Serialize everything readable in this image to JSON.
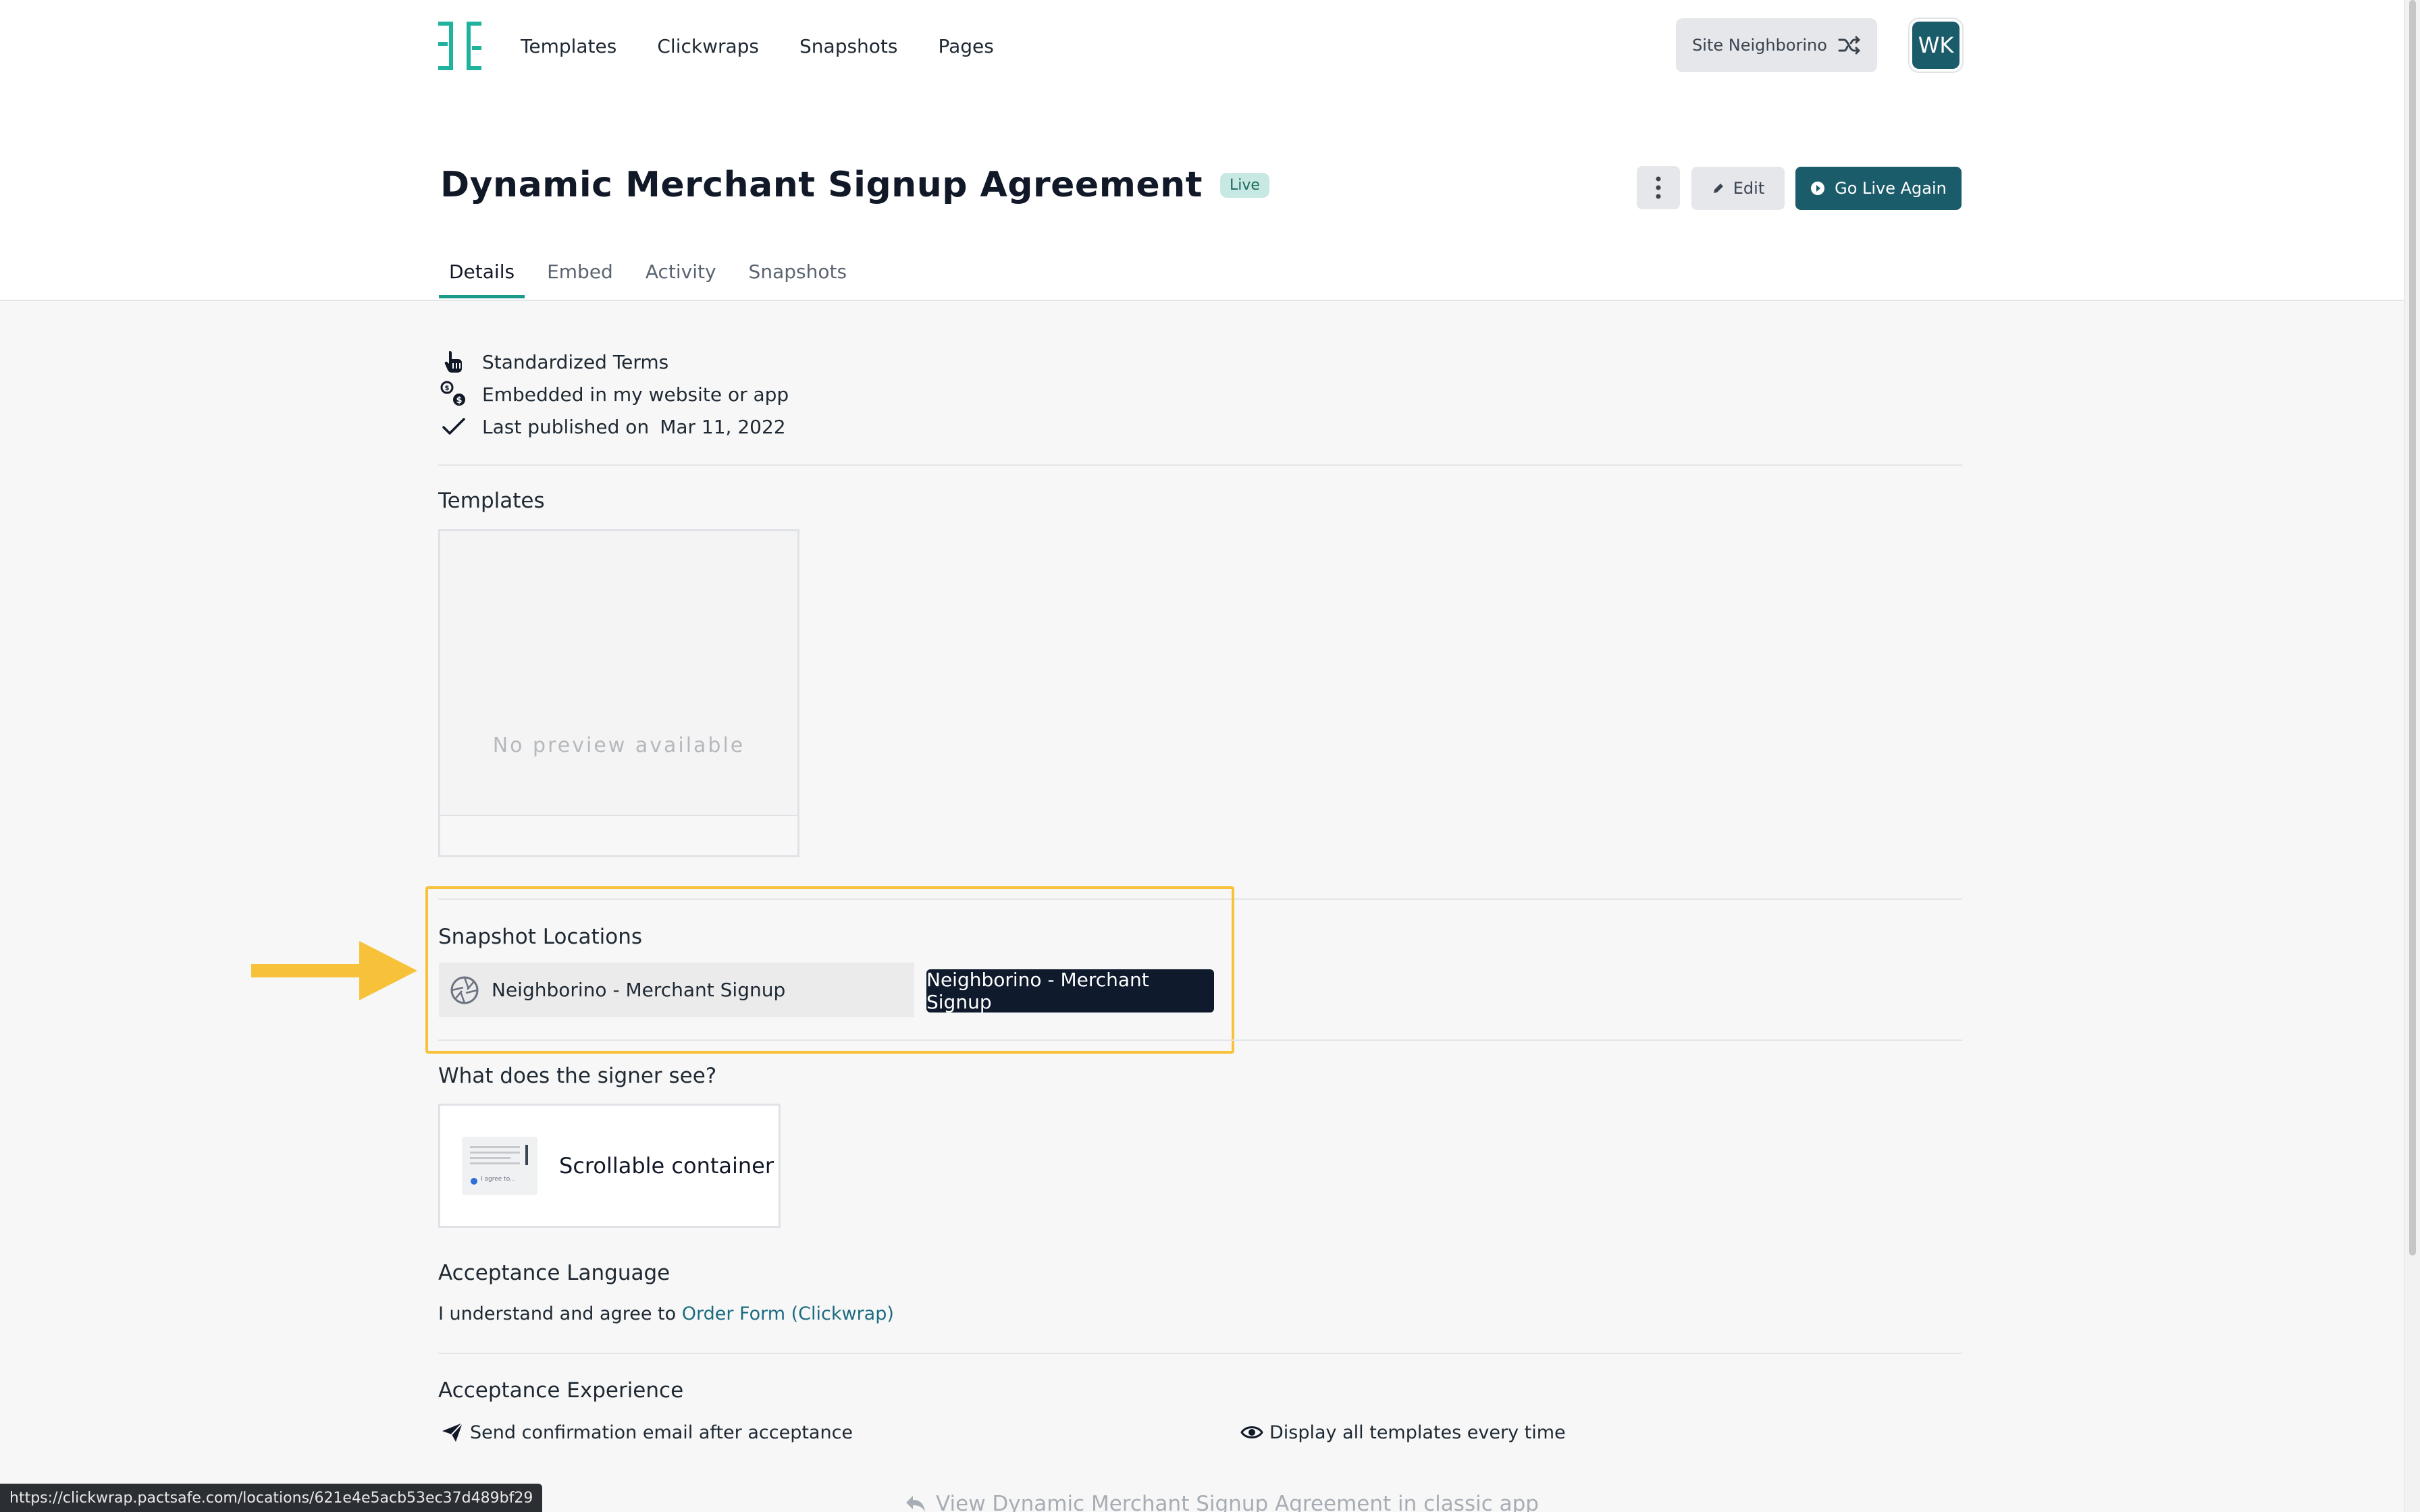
{
  "nav": {
    "logo": "pactsafe-logo",
    "links": [
      "Templates",
      "Clickwraps",
      "Snapshots",
      "Pages"
    ],
    "site_switch": "Site Neighborino",
    "avatar": "WK"
  },
  "header": {
    "title": "Dynamic Merchant Signup Agreement",
    "badge": "Live",
    "edit_label": "Edit",
    "golive_label": "Go Live Again"
  },
  "tabs": [
    {
      "label": "Details",
      "active": true
    },
    {
      "label": "Embed",
      "active": false
    },
    {
      "label": "Activity",
      "active": false
    },
    {
      "label": "Snapshots",
      "active": false
    }
  ],
  "meta": {
    "terms": "Standardized Terms",
    "embedded": "Embedded in my website or app",
    "published_label": "Last published on",
    "published_date": "Mar 11, 2022"
  },
  "templates": {
    "title": "Templates",
    "no_preview": "No preview available"
  },
  "snapshot_locations": {
    "title": "Snapshot Locations",
    "location": "Neighborino - Merchant Signup",
    "tag": "Neighborino - Merchant Signup"
  },
  "signer": {
    "title": "What does the signer see?",
    "container": "Scrollable container",
    "thumb_text": "I agree to..."
  },
  "acceptance_language": {
    "title": "Acceptance Language",
    "prefix": "I understand and agree to ",
    "link": "Order Form (Clickwrap)"
  },
  "acceptance_experience": {
    "title": "Acceptance Experience",
    "email": "Send confirmation email after acceptance",
    "display": "Display all templates every time"
  },
  "classic_link": "View Dynamic Merchant Signup Agreement in classic app",
  "status_url": "https://clickwrap.pactsafe.com/locations/621e4e5acb53ec37d489bf29",
  "colors": {
    "accent": "#1b9a8a",
    "primary": "#1b5c6b",
    "highlight": "#f7c23a",
    "dark_tag": "#0f1b2d"
  }
}
